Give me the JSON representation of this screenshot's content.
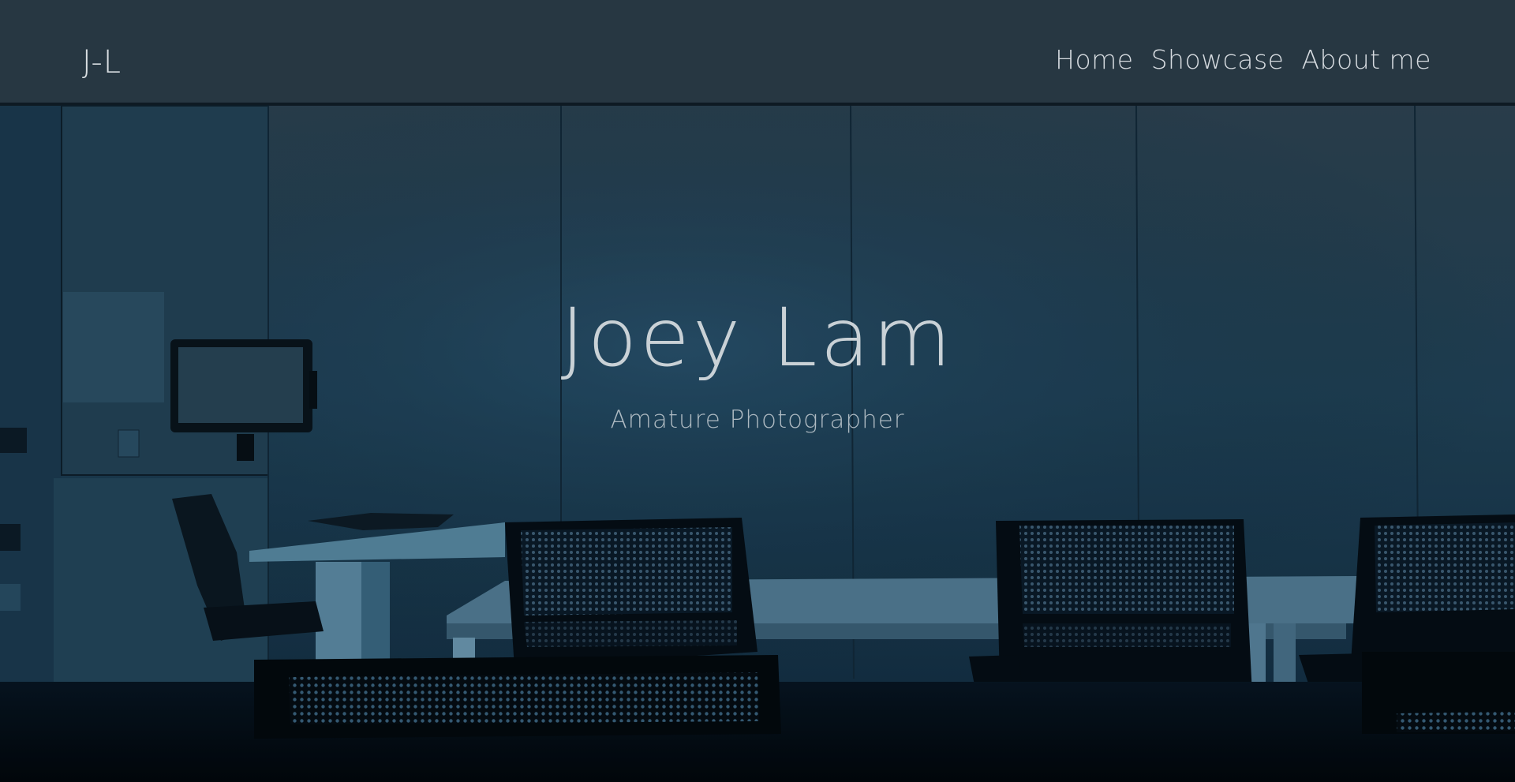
{
  "header": {
    "logo": "J-L",
    "nav": [
      {
        "label": "Home"
      },
      {
        "label": "Showcase"
      },
      {
        "label": "About me"
      }
    ]
  },
  "hero": {
    "title": "Joey Lam",
    "subtitle": "Amature Photographer",
    "background_image": "dark-blue-office-room-with-chairs-and-tables"
  },
  "colors": {
    "background": "#1e3d52",
    "text": "#d6dbe0",
    "accent": "#0e2738"
  }
}
